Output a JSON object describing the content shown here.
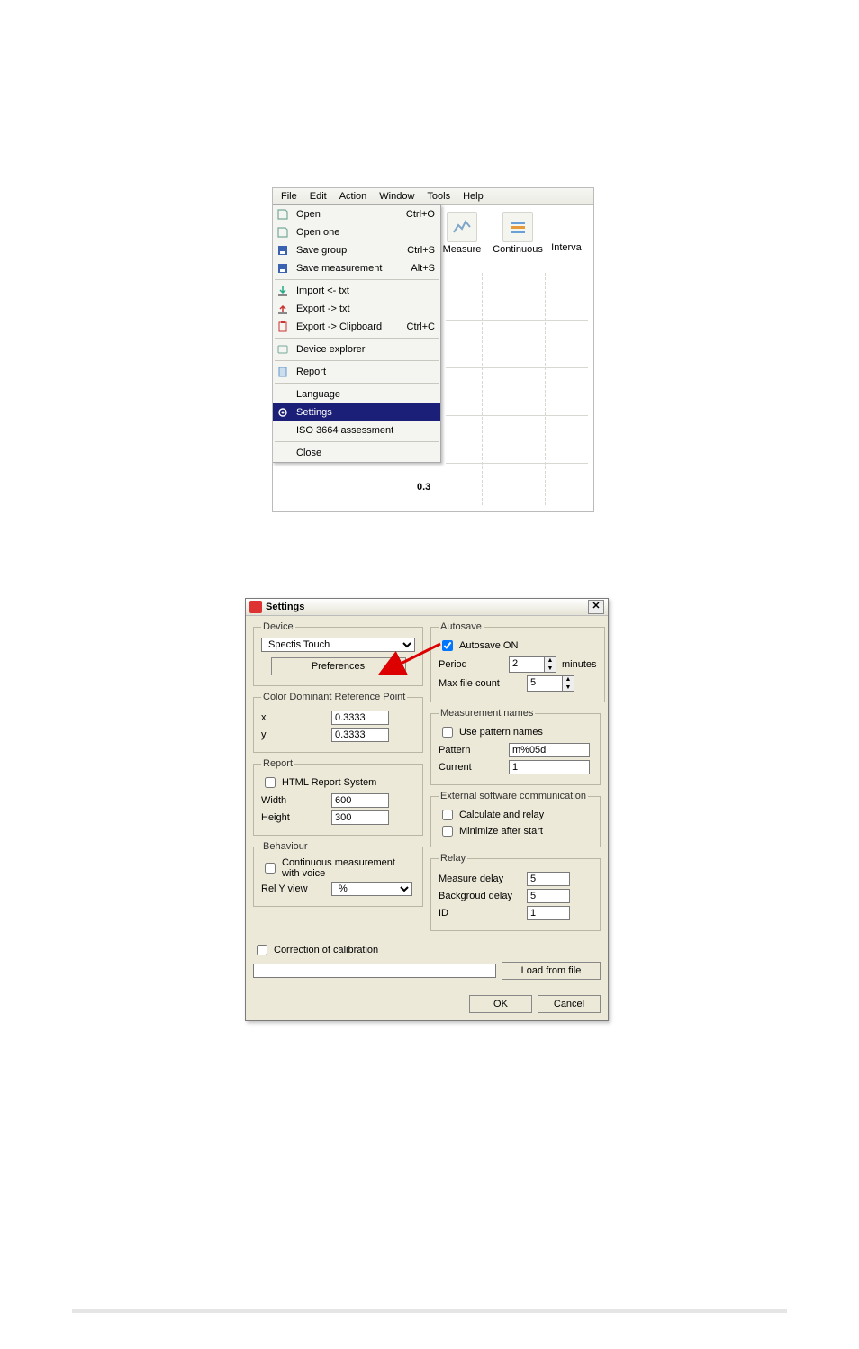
{
  "menubar": {
    "items": [
      "File",
      "Edit",
      "Action",
      "Window",
      "Tools",
      "Help"
    ]
  },
  "toolbar": {
    "measure": "Measure",
    "continuous": "Continuous",
    "interval": "Interva"
  },
  "file_menu": {
    "open": {
      "label": "Open",
      "shortcut": "Ctrl+O"
    },
    "open_one": {
      "label": "Open one",
      "shortcut": ""
    },
    "save_group": {
      "label": "Save group",
      "shortcut": "Ctrl+S"
    },
    "save_meas": {
      "label": "Save measurement",
      "shortcut": "Alt+S"
    },
    "import_txt": {
      "label": "Import <- txt",
      "shortcut": ""
    },
    "export_txt": {
      "label": "Export -> txt",
      "shortcut": ""
    },
    "export_clip": {
      "label": "Export -> Clipboard",
      "shortcut": "Ctrl+C"
    },
    "device_explorer": {
      "label": "Device explorer",
      "shortcut": ""
    },
    "report": {
      "label": "Report",
      "shortcut": ""
    },
    "language": {
      "label": "Language",
      "shortcut": ""
    },
    "settings": {
      "label": "Settings",
      "shortcut": ""
    },
    "iso": {
      "label": "ISO 3664 assessment",
      "shortcut": ""
    },
    "close": {
      "label": "Close",
      "shortcut": ""
    }
  },
  "chart_data": {
    "type": "line",
    "title": "",
    "xlabel": "",
    "ylabel": "",
    "series": [],
    "y_ticks_visible": [
      0.3
    ],
    "note": "Only an empty dashed grid is visible with a single y-axis tick label 0.3"
  },
  "settings": {
    "title": "Settings",
    "device": {
      "legend": "Device",
      "selected": "Spectis Touch",
      "preferences_btn": "Preferences"
    },
    "cdrp": {
      "legend": "Color Dominant Reference Point",
      "x_label": "x",
      "x_value": "0.3333",
      "y_label": "y",
      "y_value": "0.3333"
    },
    "report": {
      "legend": "Report",
      "html_label": "HTML Report System",
      "html_checked": false,
      "width_label": "Width",
      "width_value": "600",
      "height_label": "Height",
      "height_value": "300"
    },
    "behaviour": {
      "legend": "Behaviour",
      "cmv_label": "Continuous measurement with voice",
      "cmv_checked": false,
      "rely_label": "Rel Y view",
      "rely_value": "%"
    },
    "autosave": {
      "legend": "Autosave",
      "on_label": "Autosave ON",
      "on_checked": true,
      "period_label": "Period",
      "period_value": "2",
      "period_unit": "minutes",
      "max_label": "Max file count",
      "max_value": "5"
    },
    "meas_names": {
      "legend": "Measurement names",
      "use_label": "Use pattern names",
      "use_checked": false,
      "pattern_label": "Pattern",
      "pattern_value": "m%05d",
      "current_label": "Current",
      "current_value": "1"
    },
    "extcom": {
      "legend": "External software communication",
      "calc_label": "Calculate and relay",
      "calc_checked": false,
      "min_label": "Minimize after start",
      "min_checked": false
    },
    "relay": {
      "legend": "Relay",
      "measure_label": "Measure delay",
      "measure_value": "5",
      "bg_label": "Backgroud delay",
      "bg_value": "5",
      "id_label": "ID",
      "id_value": "1"
    },
    "correction": {
      "label": "Correction of calibration",
      "checked": false,
      "path_value": ""
    },
    "load_btn": "Load from file",
    "ok_btn": "OK",
    "cancel_btn": "Cancel"
  }
}
